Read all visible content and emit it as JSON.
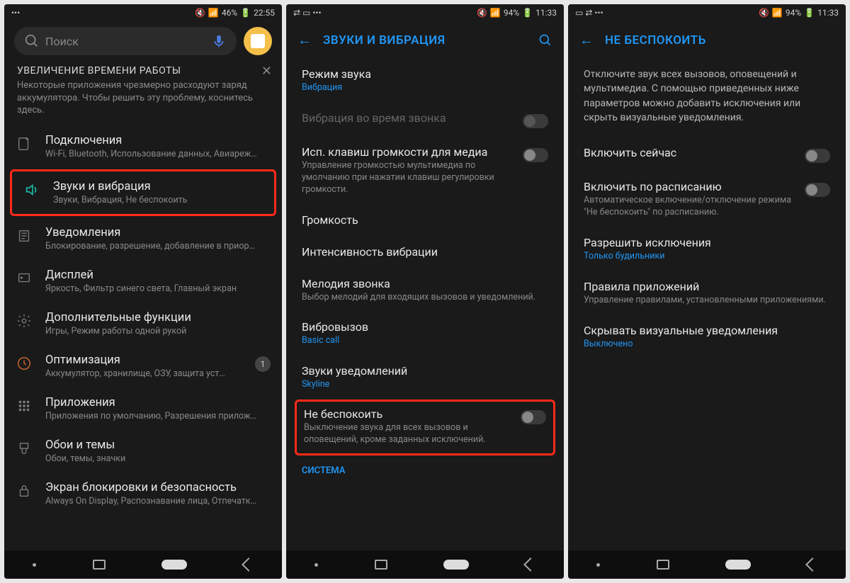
{
  "p1": {
    "status": {
      "left": "•••",
      "battery": "46%",
      "time": "22:55",
      "signal": "📶"
    },
    "search_placeholder": "Поиск",
    "tip_title": "УВЕЛИЧЕНИЕ ВРЕМЕНИ РАБОТЫ",
    "tip_text": "Некоторые приложения чрезмерно расходуют заряд аккумулятора. Чтобы решить эту проблему, коснитесь здесь.",
    "items": [
      {
        "title": "Подключения",
        "sub": "Wi-Fi, Bluetooth, Использование данных, Авиареж…"
      },
      {
        "title": "Звуки и вибрация",
        "sub": "Звуки, Вибрация, Не беспокоить"
      },
      {
        "title": "Уведомления",
        "sub": "Блокирование, разрешение, добавление в приор…"
      },
      {
        "title": "Дисплей",
        "sub": "Яркость, Фильтр синего света, Главный экран"
      },
      {
        "title": "Дополнительные функции",
        "sub": "Игры, Режим работы одной рукой"
      },
      {
        "title": "Оптимизация",
        "sub": "Аккумулятор, хранилище, ОЗУ, защита уст…",
        "badge": "1"
      },
      {
        "title": "Приложения",
        "sub": "Приложения по умолчанию, Разрешения прилож…"
      },
      {
        "title": "Обои и темы",
        "sub": "Обои, темы, значки"
      },
      {
        "title": "Экран блокировки и безопасность",
        "sub": "Always On Display, Распознавание лица, Отпечатк…"
      }
    ]
  },
  "p2": {
    "status": {
      "battery": "94%",
      "time": "11:33"
    },
    "title": "ЗВУКИ И ВИБРАЦИЯ",
    "settings": [
      {
        "title": "Режим звука",
        "sub": "Вибрация",
        "sub_blue": true
      },
      {
        "title": "Вибрация во время звонка",
        "dim": true,
        "toggle": true
      },
      {
        "title": "Исп. клавиш громкости для медиа",
        "sub": "Управление громкостью мультимедиа по умолчанию при нажатии клавиш регулировки громкости.",
        "toggle": true
      },
      {
        "title": "Громкость"
      },
      {
        "title": "Интенсивность вибрации"
      },
      {
        "title": "Мелодия звонка",
        "sub": "Выбор мелодий для входящих вызовов и уведомлений."
      },
      {
        "title": "Вибровызов",
        "sub": "Basic call",
        "sub_blue": true
      },
      {
        "title": "Звуки уведомлений",
        "sub": "Skyline",
        "sub_blue": true
      },
      {
        "title": "Не беспокоить",
        "sub": "Выключение звука для всех вызовов и оповещений, кроме заданных исключений.",
        "toggle": true,
        "highlight": true
      }
    ],
    "system_label": "СИСТЕМА"
  },
  "p3": {
    "status": {
      "battery": "94%",
      "time": "11:33"
    },
    "title": "НЕ БЕСПОКОИТЬ",
    "intro": "Отключите звук всех вызовов, оповещений и мультимедиа. С помощью приведенных ниже параметров можно добавить исключения или скрыть визуальные уведомления.",
    "settings": [
      {
        "title": "Включить сейчас",
        "toggle": true
      },
      {
        "title": "Включить по расписанию",
        "sub": "Автоматическое включение/отключение режима \"Не беспокоить\" по расписанию.",
        "toggle": true
      },
      {
        "title": "Разрешить исключения",
        "sub": "Только будильники",
        "sub_blue": true
      },
      {
        "title": "Правила приложений",
        "sub": "Управление правилами, установленными приложениями."
      },
      {
        "title": "Скрывать визуальные уведомления",
        "sub": "Выключено",
        "sub_blue": true
      }
    ]
  }
}
